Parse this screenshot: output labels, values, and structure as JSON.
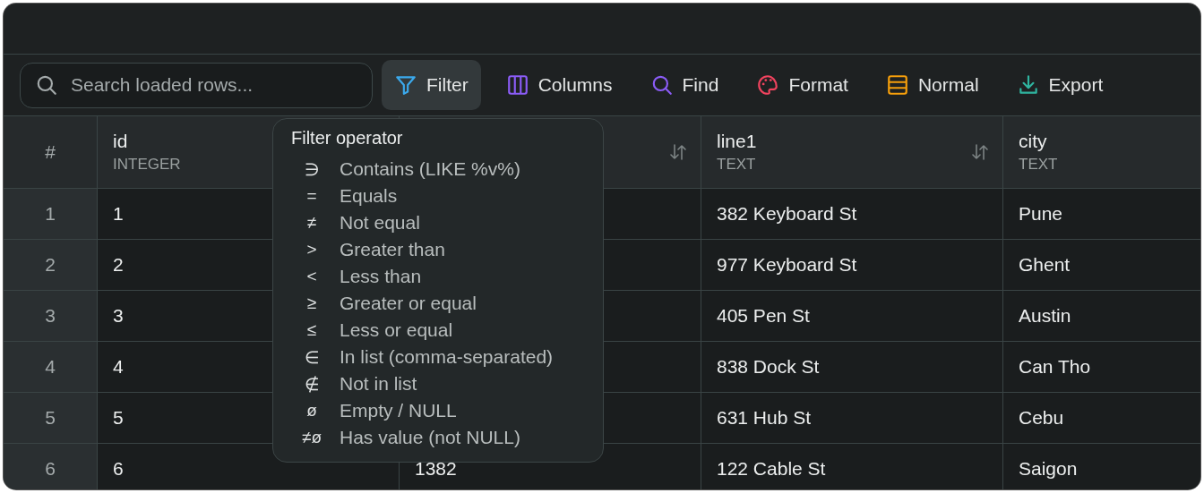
{
  "toolbar": {
    "search": {
      "placeholder": "Search loaded rows..."
    },
    "buttons": [
      {
        "label": "Filter",
        "kind": "funnel",
        "color": "#3ba9ec",
        "selected": true
      },
      {
        "label": "Columns",
        "kind": "columns",
        "color": "#8b5cf6",
        "selected": false
      },
      {
        "label": "Find",
        "kind": "search",
        "color": "#8b5cf6",
        "selected": false
      },
      {
        "label": "Format",
        "kind": "palette",
        "color": "#f0435e",
        "selected": false
      },
      {
        "label": "Normal",
        "kind": "rows",
        "color": "#f59e0b",
        "selected": false
      },
      {
        "label": "Export",
        "kind": "download",
        "color": "#2fb5a0",
        "selected": false
      }
    ]
  },
  "table": {
    "index_header": "#",
    "columns": [
      {
        "name": "id",
        "type": "INTEGER"
      },
      {
        "sort_icon": true
      },
      {
        "name": "line1",
        "type": "TEXT",
        "sort_icon": true
      },
      {
        "name": "city",
        "type": "TEXT"
      }
    ],
    "rows": [
      {
        "index": "1",
        "cells": [
          "1",
          null,
          "382 Keyboard St",
          "Pune"
        ]
      },
      {
        "index": "2",
        "cells": [
          "2",
          null,
          "977 Keyboard St",
          "Ghent"
        ]
      },
      {
        "index": "3",
        "cells": [
          "3",
          null,
          "405 Pen St",
          "Austin"
        ]
      },
      {
        "index": "4",
        "cells": [
          "4",
          null,
          "838 Dock St",
          "Can Tho"
        ]
      },
      {
        "index": "5",
        "cells": [
          "5",
          null,
          "631 Hub St",
          "Cebu"
        ]
      },
      {
        "index": "6",
        "cells": [
          "6",
          "1382",
          "122 Cable St",
          "Saigon"
        ]
      }
    ]
  },
  "filter_menu": {
    "title": "Filter operator",
    "operators": [
      {
        "symbol": "∋",
        "label": "Contains (LIKE %v%)"
      },
      {
        "symbol": "=",
        "label": "Equals"
      },
      {
        "symbol": "≠",
        "label": "Not equal"
      },
      {
        "symbol": ">",
        "label": "Greater than"
      },
      {
        "symbol": "<",
        "label": "Less than"
      },
      {
        "symbol": "≥",
        "label": "Greater or equal"
      },
      {
        "symbol": "≤",
        "label": "Less or equal"
      },
      {
        "symbol": "∈",
        "label": "In list (comma-separated)"
      },
      {
        "symbol": "∉",
        "label": "Not in list"
      },
      {
        "symbol": "ø",
        "label": "Empty / NULL"
      },
      {
        "symbol": "≠ø",
        "label": "Has value (not NULL)"
      }
    ]
  }
}
